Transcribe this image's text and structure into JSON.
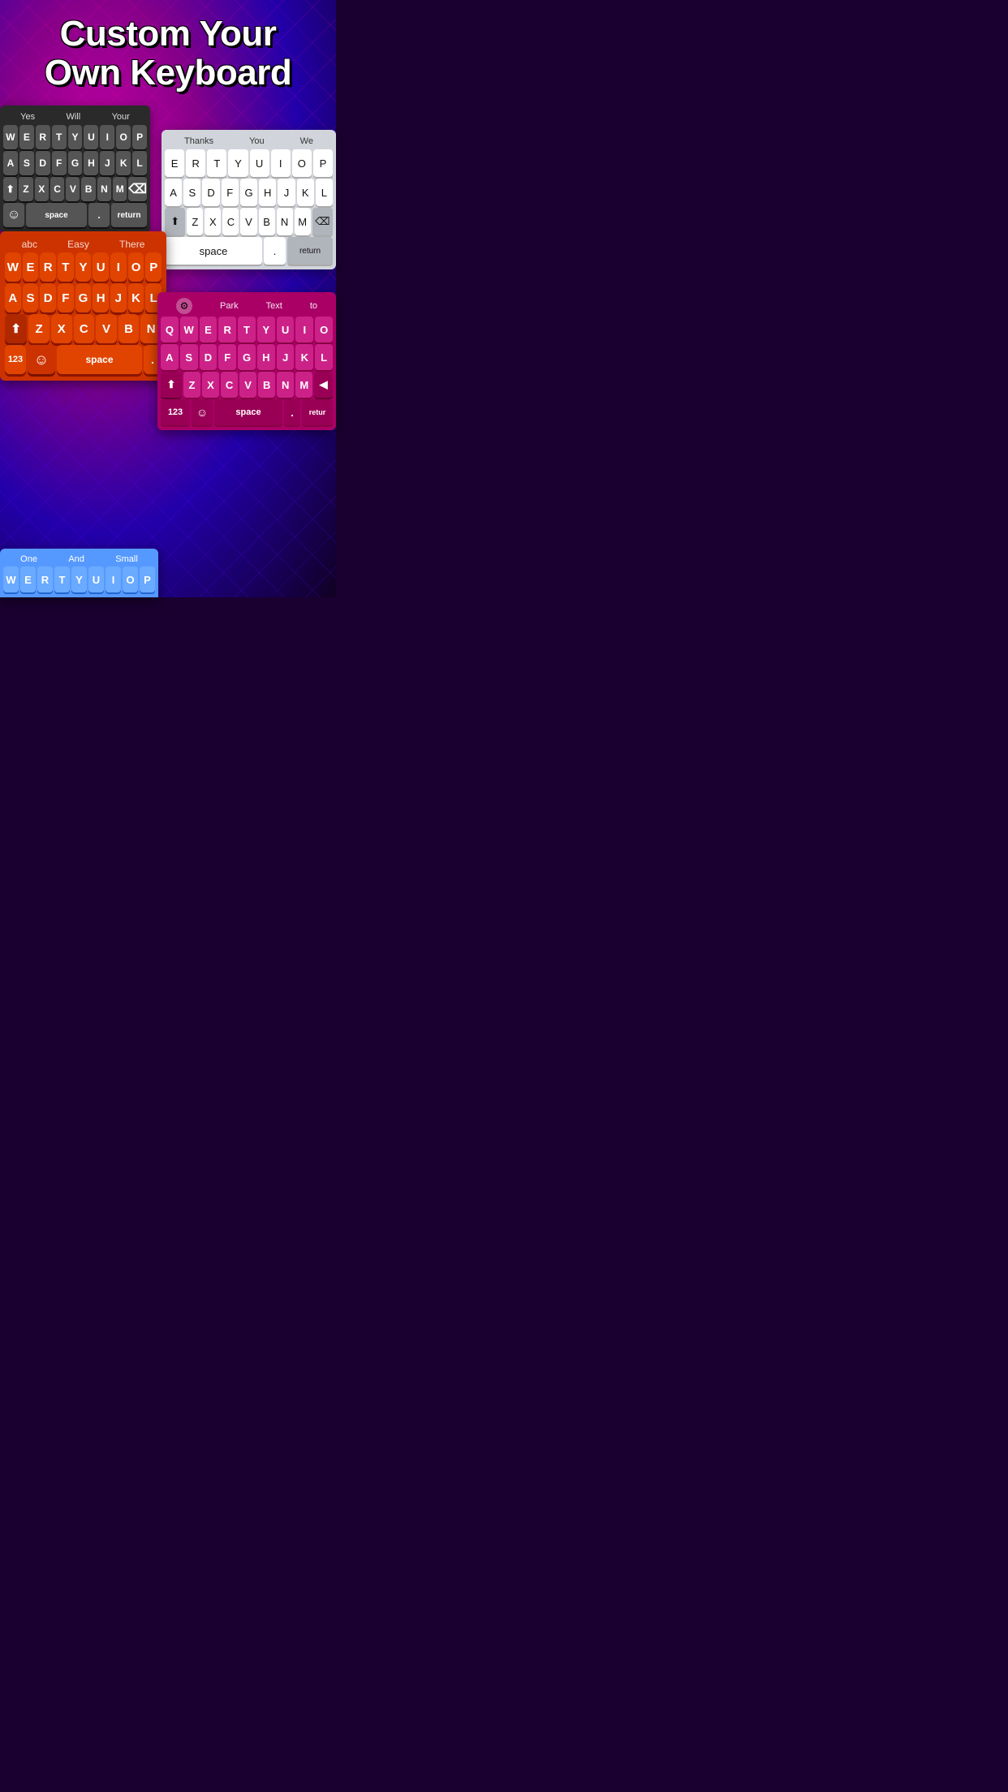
{
  "title": {
    "line1": "Custom Your",
    "line2": "Own Keyboard"
  },
  "keyboards": {
    "dark": {
      "suggestions": [
        "Yes",
        "Will",
        "Your"
      ],
      "rows": [
        [
          "W",
          "E",
          "R",
          "T",
          "Y",
          "U",
          "I",
          "O",
          "P"
        ],
        [
          "A",
          "S",
          "D",
          "F",
          "G",
          "H",
          "J",
          "K",
          "L"
        ],
        [
          "⇧",
          "Z",
          "X",
          "C",
          "V",
          "B",
          "N",
          "M",
          "⌫"
        ],
        [
          "☺",
          "space",
          ".",
          "return"
        ]
      ]
    },
    "white": {
      "suggestions": [
        "Thanks",
        "You",
        "We"
      ],
      "rows": [
        [
          "E",
          "R",
          "T",
          "Y",
          "U",
          "I",
          "O",
          "P"
        ],
        [
          "A",
          "S",
          "D",
          "F",
          "G",
          "H",
          "J",
          "K",
          "L"
        ],
        [
          "⬆",
          "Z",
          "X",
          "C",
          "V",
          "B",
          "N",
          "M",
          "⌫"
        ],
        [
          "space",
          ".",
          "return"
        ]
      ]
    },
    "orange": {
      "suggestions": [
        "abc",
        "Easy",
        "There"
      ],
      "rows": [
        [
          "W",
          "E",
          "R",
          "T",
          "Y",
          "U",
          "I",
          "O",
          "P"
        ],
        [
          "A",
          "S",
          "D",
          "F",
          "G",
          "H",
          "J",
          "K",
          "L"
        ],
        [
          "⬆",
          "Z",
          "X",
          "C",
          "V",
          "B",
          "N"
        ],
        [
          "123",
          "☺",
          "space",
          "."
        ]
      ]
    },
    "pink": {
      "suggestions": [
        "⚙",
        "Park",
        "Text",
        "to"
      ],
      "rows": [
        [
          "Q",
          "W",
          "E",
          "R",
          "T",
          "Y",
          "U",
          "I",
          "O"
        ],
        [
          "A",
          "S",
          "D",
          "F",
          "G",
          "H",
          "J",
          "K",
          "L"
        ],
        [
          "⬆",
          "Z",
          "X",
          "C",
          "V",
          "B",
          "N",
          "M",
          "◀"
        ],
        [
          "123",
          "☺",
          "space",
          ".",
          "retu"
        ]
      ]
    },
    "blue": {
      "suggestions": [
        "One",
        "And",
        "Small"
      ],
      "rows": [
        [
          "W",
          "E",
          "R",
          "T",
          "Y",
          "U",
          "I",
          "O",
          "P"
        ]
      ]
    }
  },
  "colors": {
    "bg_top": "#cc00aa",
    "bg_bottom": "#2200aa",
    "dark_key": "#555555",
    "orange_key": "#e04400",
    "pink_key": "#cc2288",
    "blue_key": "#6aaaff"
  }
}
